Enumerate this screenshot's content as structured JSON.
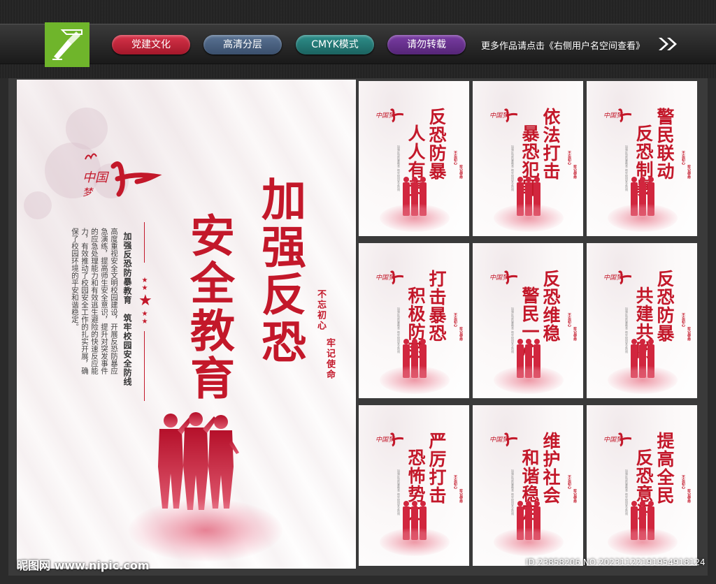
{
  "topbar": {
    "tags": [
      {
        "label": "党建文化",
        "color": "#c8263c"
      },
      {
        "label": "高清分层",
        "color": "#4a6282"
      },
      {
        "label": "CMYK模式",
        "color": "#237a76"
      },
      {
        "label": "请勿转载",
        "color": "#67308e"
      }
    ],
    "more_text": "更多作品请点击《右侧用户名空间查看》"
  },
  "main_poster": {
    "logo_text": "中国梦",
    "title_line1": "加强反恐",
    "title_line2": "安全教育",
    "subtitle": "加强反恐防暴教育　筑牢校园安全防线",
    "body": "高度重视安全文明校园建设，开展反恐防暴应急演练，提高师生安全意识，提升对突发事件的应急处理能力和有效逃生避险的快速反应能力，有效推动了校园安全工作的扎实开展，确保了校园环境的平安和谐稳定。",
    "slogan1": "不忘初心",
    "slogan2": "牢记使命"
  },
  "small_posters": [
    {
      "line1": "反恐防暴",
      "line2": "人人有责"
    },
    {
      "line1": "依法打击",
      "line2": "暴恐犯罪"
    },
    {
      "line1": "警民联动",
      "line2": "反恐制暴"
    },
    {
      "line1": "打击暴恐",
      "line2": "积极防范"
    },
    {
      "line1": "反恐维稳",
      "line2": "警民一心"
    },
    {
      "line1": "反恐防暴",
      "line2": "共建共防"
    },
    {
      "line1": "严厉打击",
      "line2": "恐怖势力"
    },
    {
      "line1": "维护社会",
      "line2": "和谐稳定"
    },
    {
      "line1": "提高全民",
      "line2": "反恐意识"
    }
  ],
  "small_body": "加强反恐防暴教育 筑牢校园安全防线",
  "small_slogan1": "不忘初心",
  "small_slogan2": "牢记使命",
  "footer": {
    "watermark": "昵图网 www.nipic.com",
    "id_text": "ID:23858206 NO:20231122191954918124"
  },
  "colors": {
    "accent_red": "#c3182a"
  }
}
